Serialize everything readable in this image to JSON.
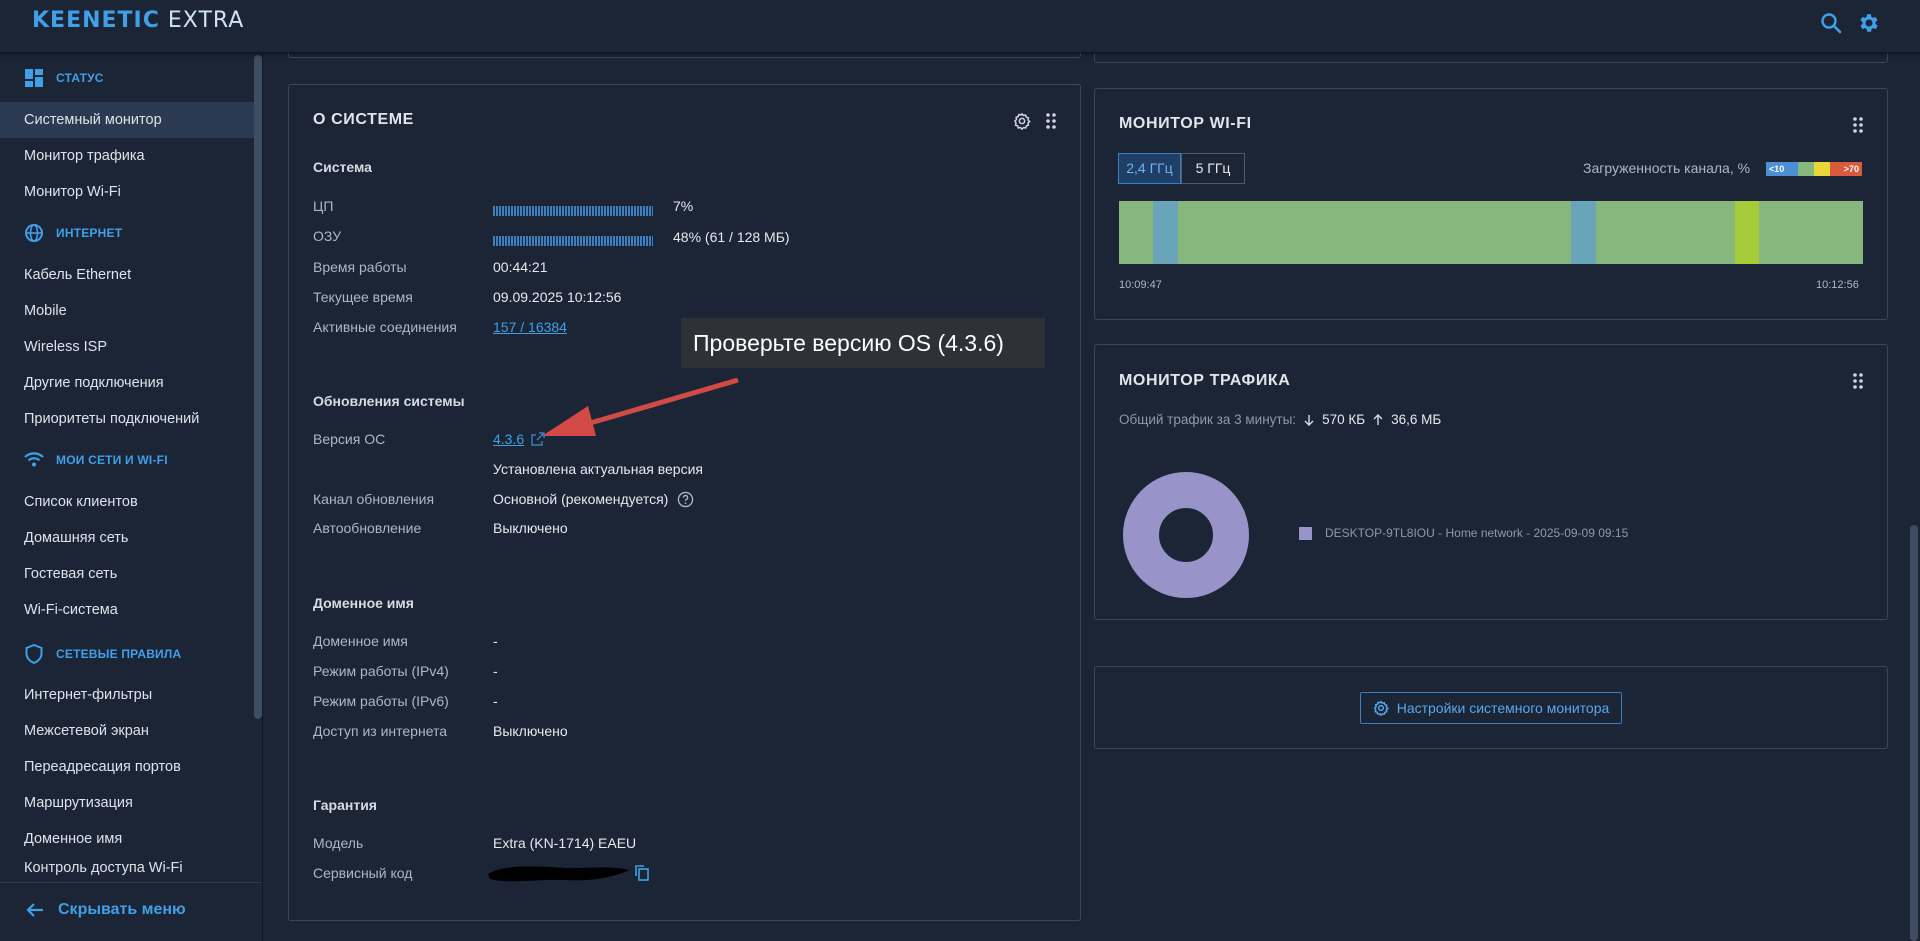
{
  "header": {
    "brand": "KEENETIC",
    "model": "EXTRA"
  },
  "sidebar": {
    "sections": [
      {
        "title": "СТАТУС",
        "icon": "dashboard-icon"
      },
      {
        "title": "ИНТЕРНЕТ",
        "icon": "globe-icon"
      },
      {
        "title": "МОИ СЕТИ И WI-FI",
        "icon": "wifi-icon"
      },
      {
        "title": "СЕТЕВЫЕ ПРАВИЛА",
        "icon": "shield-icon"
      }
    ],
    "items": [
      "Системный монитор",
      "Монитор трафика",
      "Монитор Wi-Fi",
      "Кабель Ethernet",
      "Mobile",
      "Wireless ISP",
      "Другие подключения",
      "Приоритеты подключений",
      "Список клиентов",
      "Домашняя сеть",
      "Гостевая сеть",
      "Wi-Fi-система",
      "Интернет-фильтры",
      "Межсетевой экран",
      "Переадресация портов",
      "Маршрутизация",
      "Доменное имя",
      "Контроль доступа Wi-Fi"
    ],
    "hide_menu": "Скрывать меню"
  },
  "system": {
    "title": "О СИСТЕМЕ",
    "section_system": "Система",
    "cpu_label": "ЦП",
    "cpu_value": "7%",
    "cpu_load": 0.07,
    "ram_label": "ОЗУ",
    "ram_value": "48% (61 / 128 МБ)",
    "ram_load": 0.48,
    "uptime_label": "Время работы",
    "uptime_value": "00:44:21",
    "time_label": "Текущее время",
    "time_value": "09.09.2025 10:12:56",
    "conn_label": "Активные соединения",
    "conn_value": "157 / 16384",
    "section_updates": "Обновления системы",
    "os_label": "Версия ОС",
    "os_value": "4.3.6",
    "os_status": "Установлена актуальная версия",
    "channel_label": "Канал обновления",
    "channel_value": "Основной (рекомендуется)",
    "auto_label": "Автообновление",
    "auto_value": "Выключено",
    "section_domain": "Доменное имя",
    "domain_label": "Доменное имя",
    "domain_value": "-",
    "mode4_label": "Режим работы (IPv4)",
    "mode4_value": "-",
    "mode6_label": "Режим работы (IPv6)",
    "mode6_value": "-",
    "access_label": "Доступ из интернета",
    "access_value": "Выключено",
    "section_warranty": "Гарантия",
    "model_label": "Модель",
    "model_value": "Extra (KN-1714) EAEU",
    "service_label": "Сервисный код"
  },
  "callout": {
    "text": "Проверьте версию OS (4.3.6)"
  },
  "wifi_monitor": {
    "title": "МОНИТОР WI-FI",
    "tab_24": "2,4 ГГц",
    "tab_5": "5 ГГц",
    "load_label": "Загруженность канала, %",
    "scale_low": "<10",
    "scale_high": ">70",
    "time_start": "10:09:47",
    "time_end": "10:12:56",
    "colors": {
      "good": "#86b87e",
      "blue": "#6aa4b8",
      "yellow": "#a6cc3a"
    }
  },
  "traffic_monitor": {
    "title": "МОНИТОР ТРАФИКА",
    "summary_label": "Общий трафик за 3 минуты:",
    "download": "570 КБ",
    "upload": "36,6 МБ",
    "legend": "DESKTOP-9TL8IOU - Home network - 2025-09-09 09:15",
    "color": "#9894c9"
  },
  "settings_button": "Настройки системного монитора"
}
